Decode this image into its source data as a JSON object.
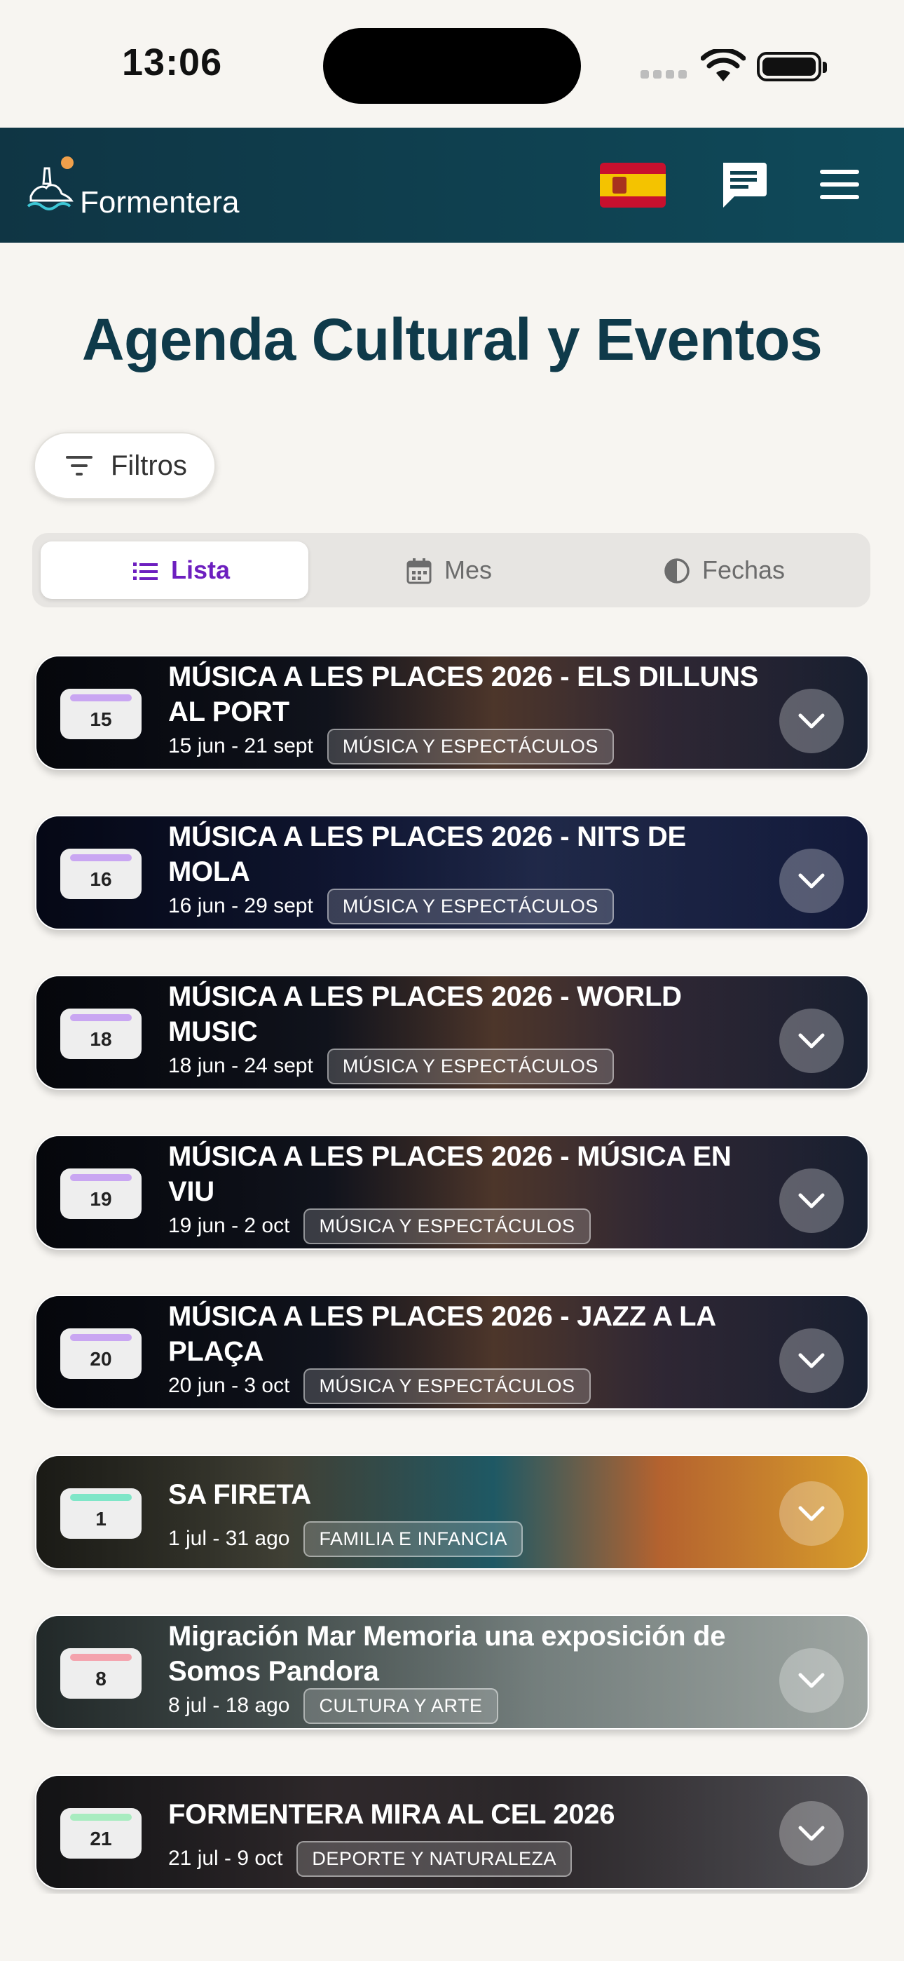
{
  "status_bar": {
    "time": "13:06"
  },
  "header": {
    "logo_text": "Formentera",
    "language_flag": "spain-flag",
    "chat_icon": "chat-icon",
    "menu_icon": "hamburger-menu-icon"
  },
  "page": {
    "title": "Agenda Cultural y Eventos"
  },
  "filters": {
    "label": "Filtros",
    "icon": "filter-icon"
  },
  "view_tabs": [
    {
      "label": "Lista",
      "icon": "list-icon",
      "active": true
    },
    {
      "label": "Mes",
      "icon": "calendar-icon",
      "active": false
    },
    {
      "label": "Fechas",
      "icon": "half-circle-icon",
      "active": false
    }
  ],
  "events": [
    {
      "day": "15",
      "title_line1": "MÚSICA A LES PLACES 2026 - ELS DILLUNS",
      "title_line2": "AL PORT",
      "dates": "15 jun - 21 sept",
      "category": "MÚSICA Y ESPECTÁCULOS",
      "stripe_color": "#c9a6f2"
    },
    {
      "day": "16",
      "title_line1": "MÚSICA A LES PLACES 2026 - NITS DE",
      "title_line2": "MOLA",
      "dates": "16 jun - 29 sept",
      "category": "MÚSICA Y ESPECTÁCULOS",
      "stripe_color": "#c9a6f2"
    },
    {
      "day": "18",
      "title_line1": "MÚSICA A LES PLACES 2026 - WORLD",
      "title_line2": "MUSIC",
      "dates": "18 jun - 24 sept",
      "category": "MÚSICA Y ESPECTÁCULOS",
      "stripe_color": "#c9a6f2"
    },
    {
      "day": "19",
      "title_line1": "MÚSICA A LES PLACES 2026 - MÚSICA EN",
      "title_line2": "VIU",
      "dates": "19 jun - 2 oct",
      "category": "MÚSICA Y ESPECTÁCULOS",
      "stripe_color": "#c9a6f2"
    },
    {
      "day": "20",
      "title_line1": "MÚSICA A LES PLACES 2026 - JAZZ A LA",
      "title_line2": "PLAÇA",
      "dates": "20 jun - 3 oct",
      "category": "MÚSICA Y ESPECTÁCULOS",
      "stripe_color": "#c9a6f2"
    },
    {
      "day": "1",
      "title_line1": "SA FIRETA",
      "title_line2": "",
      "dates": "1 jul - 31 ago",
      "category": "FAMILIA E INFANCIA",
      "stripe_color": "#7fe6c8"
    },
    {
      "day": "8",
      "title_line1": "Migración Mar Memoria una exposición de",
      "title_line2": "Somos Pandora",
      "dates": "8 jul - 18 ago",
      "category": "CULTURA Y ARTE",
      "stripe_color": "#f4a3ad"
    },
    {
      "day": "21",
      "title_line1": "FORMENTERA MIRA AL CEL 2026",
      "title_line2": "",
      "dates": "21 jul - 9 oct",
      "category": "DEPORTE Y NATURALEZA",
      "stripe_color": "#a8ecc0"
    }
  ],
  "colors": {
    "header_bg": "#0f3a4a",
    "title": "#0f3a4a",
    "active_tab": "#6d1fbf",
    "page_bg": "#f7f5f1"
  }
}
